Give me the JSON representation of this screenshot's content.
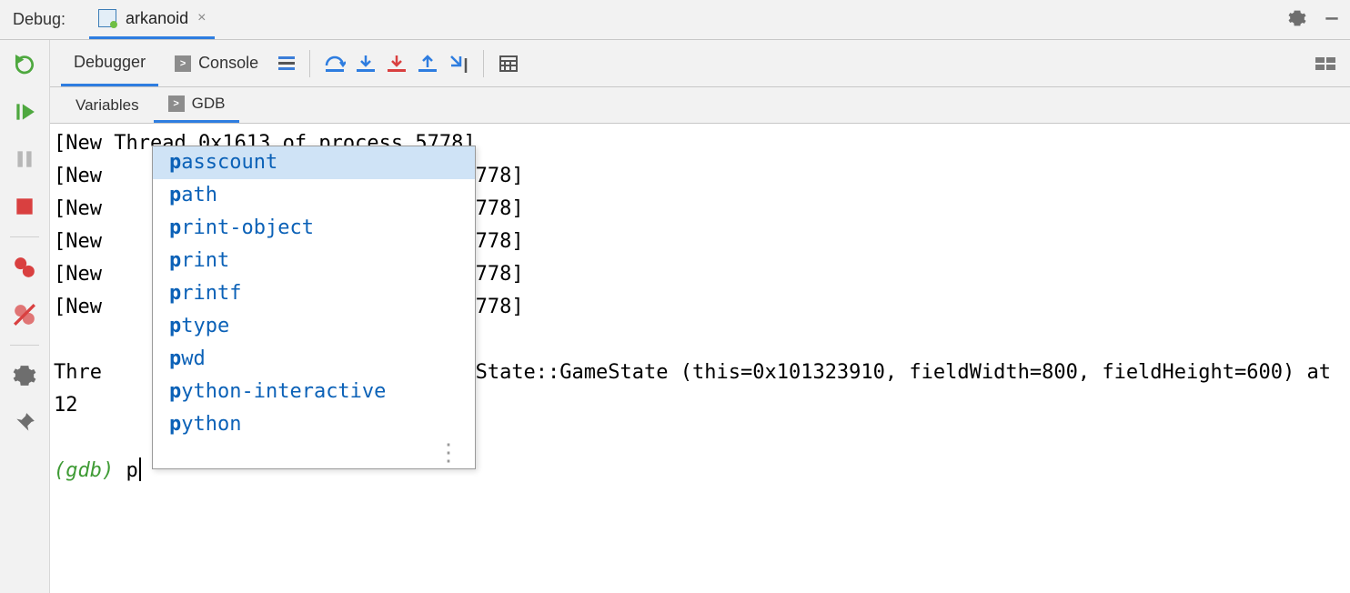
{
  "topbar": {
    "label": "Debug:",
    "tab_name": "arkanoid"
  },
  "debugger_toolbar": {
    "tab_debugger": "Debugger",
    "tab_console": "Console"
  },
  "subtabs": {
    "variables": "Variables",
    "gdb": "GDB"
  },
  "console": {
    "lines": [
      "[New Thread 0x1613 of process 5778]",
      "[New                              5778]",
      "[New                              5778]",
      "[New                              5778]",
      "[New                              5778]",
      "[New                              5778]",
      "",
      "Thre                             meState::GameState (this=0x101323910, fieldWidth=800, fieldHeight=600) at",
      "12",
      ""
    ],
    "prompt": "(gdb) ",
    "input": "p"
  },
  "autocomplete": {
    "prefix": "p",
    "items": [
      "passcount",
      "path",
      "print-object",
      "print",
      "printf",
      "ptype",
      "pwd",
      "python-interactive",
      "python"
    ],
    "selected_index": 0
  }
}
